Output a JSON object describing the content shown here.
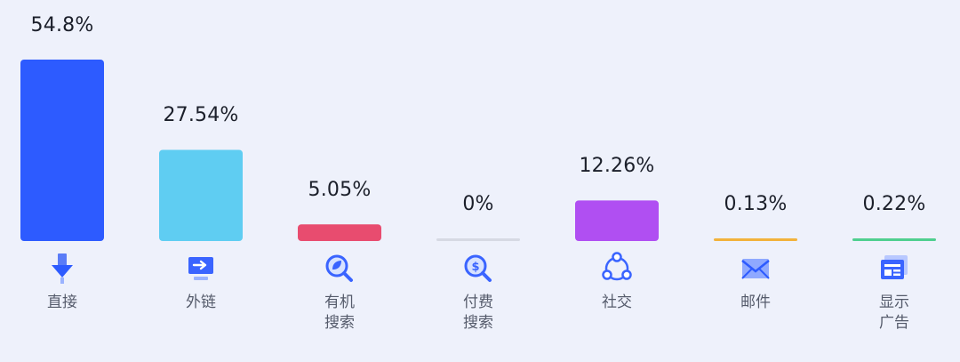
{
  "chart_data": {
    "type": "bar",
    "categories": [
      "直接",
      "外链",
      "有机\n搜索",
      "付费\n搜索",
      "社交",
      "邮件",
      "显示\n广告"
    ],
    "values": [
      54.8,
      27.54,
      5.05,
      0,
      12.26,
      0.13,
      0.22
    ],
    "value_labels": [
      "54.8%",
      "27.54%",
      "5.05%",
      "0%",
      "12.26%",
      "0.13%",
      "0.22%"
    ],
    "colors": [
      "#2d5bff",
      "#5fcdf2",
      "#e84c6f",
      "#d6d9e3",
      "#b04ff2",
      "#f2b23b",
      "#4fcf8f"
    ],
    "icons": [
      "download-arrow-icon",
      "monitor-link-icon",
      "leaf-magnifier-icon",
      "dollar-magnifier-icon",
      "share-network-icon",
      "envelope-icon",
      "display-ad-icon"
    ],
    "ylim": [
      0,
      54.8
    ]
  }
}
